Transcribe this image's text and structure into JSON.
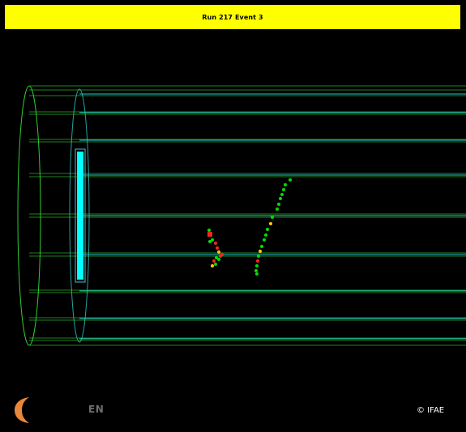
{
  "header": {
    "title": "Run 217 Event 3",
    "background_color": "#ffff00"
  },
  "footer": {
    "language_label": "EN",
    "copyright": "© IFAE",
    "logo_icon": "ifae-crescent-logo-icon"
  },
  "scene": {
    "background_color": "#000000",
    "detector_wire_color": "#33cc33",
    "detector_line_color": "#22cccc",
    "calorimeter_color": "#00ffff",
    "hit_colors": [
      "#00dd00",
      "#ff2222",
      "#ffcc00"
    ]
  }
}
